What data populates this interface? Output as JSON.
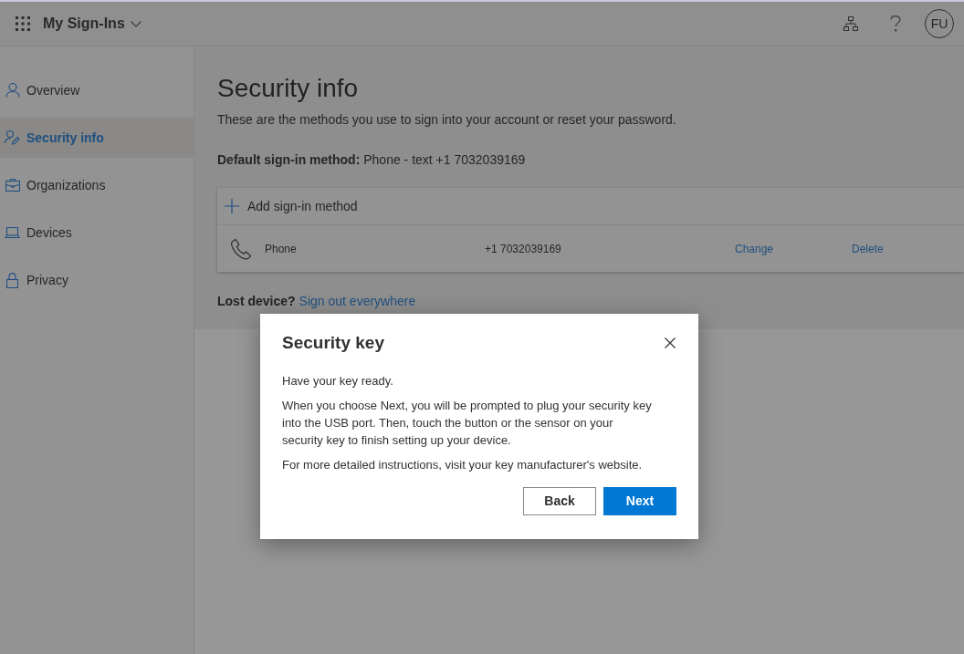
{
  "header": {
    "app_title": "My Sign-Ins",
    "avatar_initials": "FU"
  },
  "sidebar": {
    "items": [
      {
        "label": "Overview",
        "selected": false
      },
      {
        "label": "Security info",
        "selected": true
      },
      {
        "label": "Organizations",
        "selected": false
      },
      {
        "label": "Devices",
        "selected": false
      },
      {
        "label": "Privacy",
        "selected": false
      }
    ]
  },
  "page": {
    "title": "Security info",
    "subtitle": "These are the methods you use to sign into your account or reset your password.",
    "default_method": "**Default sign-in method:** Phone - text +1 7032039169"
  },
  "methods_card": {
    "add_label": "Add sign-in method",
    "methods": [
      {
        "name": "Phone",
        "value": "+1 7032039169",
        "actions": [
          "Change",
          "Delete"
        ]
      }
    ]
  },
  "lost_device": {
    "label": "Lost device?",
    "link": "Sign out everywhere"
  },
  "dialog": {
    "title": "Security key",
    "paragraphs": [
      "Have your key ready.",
      "When you choose Next, you will be prompted to plug your security key into the USB port. Then, touch the button or the sensor on your security key to finish setting up your device.",
      "For more detailed instructions, visit your key manufacturer's website."
    ],
    "buttons": [
      {
        "label": "Back",
        "primary": false
      },
      {
        "label": "Next",
        "primary": true
      }
    ]
  }
}
